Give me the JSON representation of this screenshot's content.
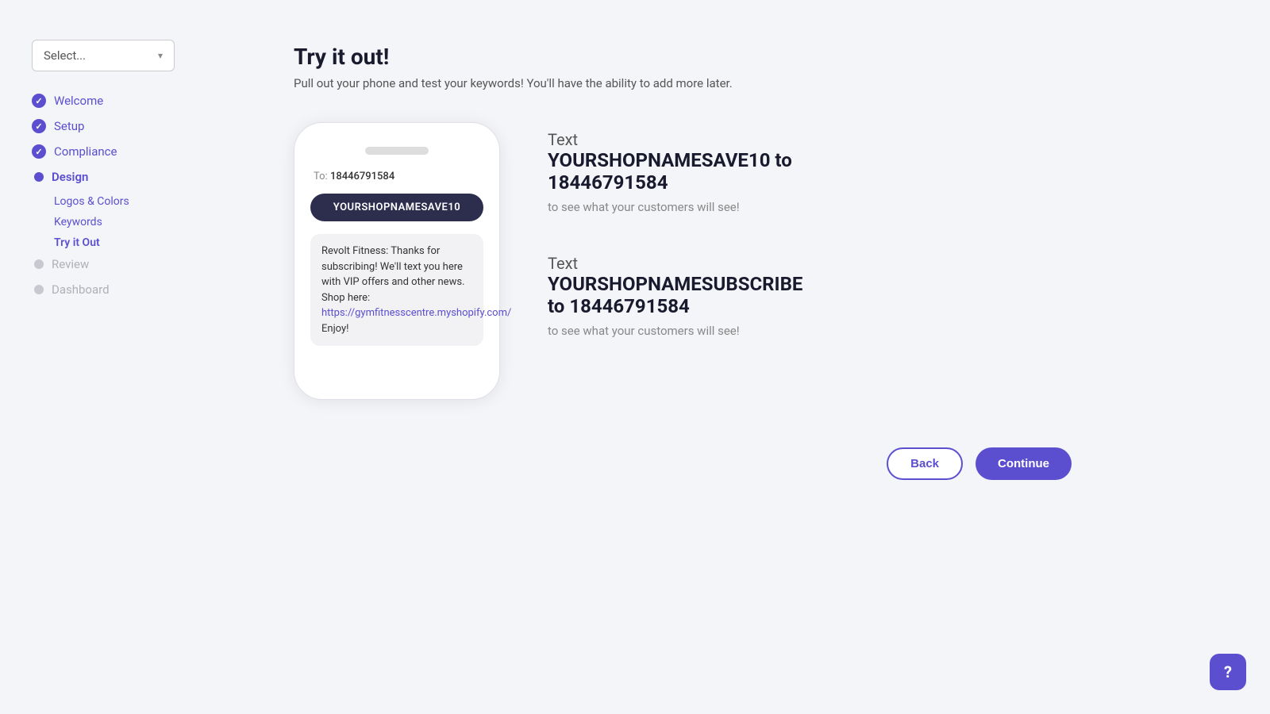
{
  "sidebar": {
    "select_placeholder": "Select...",
    "nav_items": [
      {
        "id": "welcome",
        "label": "Welcome",
        "state": "completed"
      },
      {
        "id": "setup",
        "label": "Setup",
        "state": "completed"
      },
      {
        "id": "compliance",
        "label": "Compliance",
        "state": "completed"
      },
      {
        "id": "design",
        "label": "Design",
        "state": "active",
        "subnav": [
          {
            "id": "logos-colors",
            "label": "Logos & Colors",
            "state": "done"
          },
          {
            "id": "keywords",
            "label": "Keywords",
            "state": "done"
          },
          {
            "id": "try-it-out",
            "label": "Try it Out",
            "state": "active"
          }
        ]
      },
      {
        "id": "review",
        "label": "Review",
        "state": "inactive"
      },
      {
        "id": "dashboard",
        "label": "Dashboard",
        "state": "inactive"
      }
    ]
  },
  "page": {
    "title": "Try it out!",
    "subtitle": "Pull out your phone and test your keywords! You'll have the ability to add more later."
  },
  "phone": {
    "to_label": "To:",
    "phone_number": "18446791584",
    "keyword_bubble": "YOURSHOPNAMESAVE10",
    "sms_text": "Revolt Fitness: Thanks for subscribing! We'll text you here with VIP offers and other news. Shop here: ",
    "sms_link": "https://gymfitnesscentre.myshopify.com/",
    "sms_end": " Enjoy!"
  },
  "instructions": [
    {
      "id": "instruction-1",
      "prefix": "Text",
      "keyword": "YOURSHOPNAMESAVE10 to\n18446791584",
      "cta": "to see what your customers will see!"
    },
    {
      "id": "instruction-2",
      "prefix": "Text",
      "keyword": "YOURSHOPNAMESUBSCRIBE\nto 18446791584",
      "cta": "to see what your customers will see!"
    }
  ],
  "buttons": {
    "back": "Back",
    "continue": "Continue"
  },
  "help": {
    "icon": "?"
  }
}
